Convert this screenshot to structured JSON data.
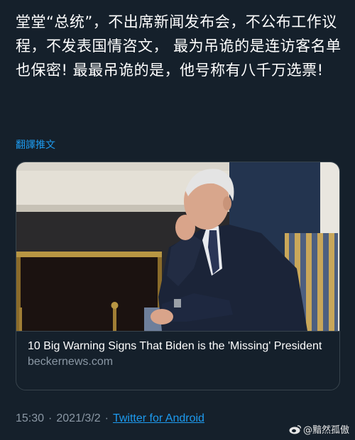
{
  "tweet": {
    "text": "堂堂“总统”，不出席新闻发布会，不公布工作议程，不发表国情咨文， 最为吊诡的是连访客名单也保密! 最最吊诡的是，他号称有八千万选票!",
    "translate_label": "翻譯推文"
  },
  "link_card": {
    "title": "10 Big Warning Signs That Biden is the 'Missing' President",
    "domain": "beckernews.com"
  },
  "meta": {
    "time": "15:30",
    "date": "2021/3/2",
    "separator": "·",
    "source": "Twitter for Android"
  },
  "watermark": {
    "handle": "@黯然孤傲",
    "icon": "weibo-icon"
  },
  "colors": {
    "background": "#15202b",
    "link": "#1d9bf0",
    "muted": "#8b98a5",
    "border": "#38444d"
  }
}
